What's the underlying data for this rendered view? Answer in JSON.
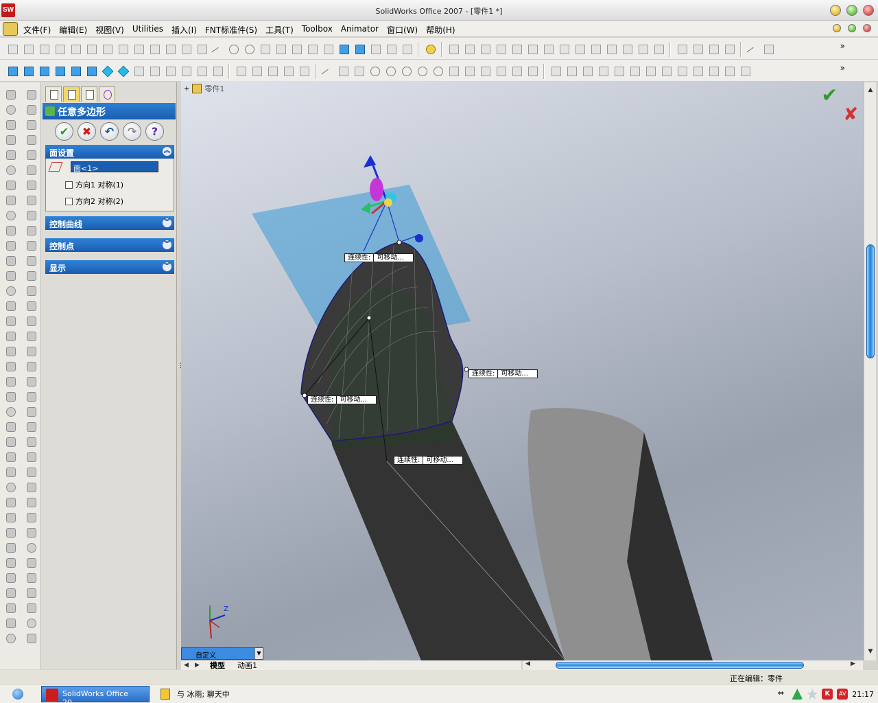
{
  "window": {
    "title": "SolidWorks Office 2007 - [零件1 *]",
    "app_icon_label": "SW"
  },
  "menu": {
    "items": [
      "文件(F)",
      "编辑(E)",
      "视图(V)",
      "Utilities",
      "插入(I)",
      "FNT标准件(S)",
      "工具(T)",
      "Toolbox",
      "Animator",
      "窗口(W)",
      "帮助(H)"
    ]
  },
  "toolbar": {
    "more_glyph": "»"
  },
  "property_manager": {
    "title": "任意多边形",
    "actions": {
      "ok": "✔",
      "cancel": "✖",
      "undo": "↶",
      "redo": "↷",
      "help": "?"
    },
    "face_settings": {
      "header": "面设置",
      "selection": "面<1>",
      "checkbox1": "方向1 对称(1)",
      "checkbox2": "方向2 对称(2)"
    },
    "control_curves": {
      "header": "控制曲线"
    },
    "control_points": {
      "header": "控制点"
    },
    "display": {
      "header": "显示"
    },
    "collapse_glyph": "︽",
    "expand_glyph": "︾"
  },
  "viewport": {
    "tree_expander": "+",
    "tree_part": "零件1",
    "confirm_ok": "✔",
    "confirm_cancel": "✘",
    "callouts": [
      {
        "key": "连续性:",
        "value": "可移动..."
      },
      {
        "key": "连续性:",
        "value": "可移动..."
      },
      {
        "key": "连续性:",
        "value": "可移动..."
      },
      {
        "key": "连续性:",
        "value": "可移动..."
      }
    ],
    "triad_axis_z": "Z"
  },
  "view_selector": {
    "value": "自定义",
    "dropdown_glyph": "▼"
  },
  "bottom_tabs": {
    "nav_prev": "◀",
    "nav_next": "▶",
    "tabs": [
      "模型",
      "动画1"
    ]
  },
  "status": {
    "text": "正在编辑：零件"
  },
  "taskbar": {
    "tasks": [
      "SolidWorks Office 20...",
      "与 冰雨; 聊天中"
    ],
    "time": "21:17",
    "av_label": "AV",
    "k_label": "K"
  },
  "colors": {
    "accent_blue": "#1b5eb0",
    "selection_plane": "#3a9bd7",
    "surface": "#3c3c3c",
    "ok_green": "#2f9a2a",
    "cancel_red": "#d23232"
  }
}
